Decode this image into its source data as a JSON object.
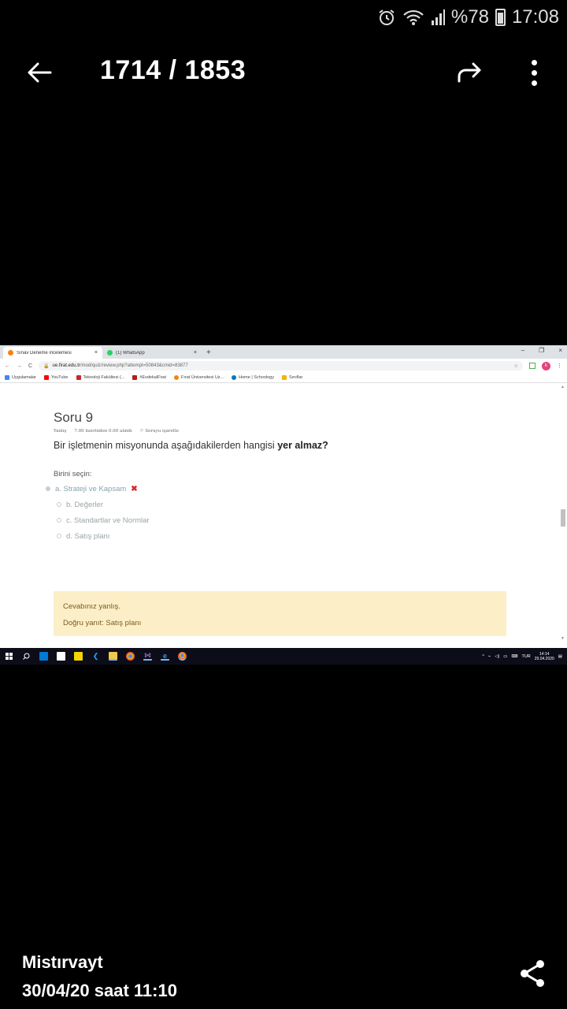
{
  "status_bar": {
    "battery": "%78",
    "time": "17:08",
    "icons": [
      "alarm-icon",
      "wifi-icon",
      "signal-icon",
      "battery-icon"
    ]
  },
  "app_bar": {
    "counter": "1714 / 1853",
    "icons": [
      "back-arrow-icon",
      "share-arrow-icon",
      "more-vert-icon"
    ]
  },
  "browser": {
    "tabs": [
      {
        "title": "Sınav Deneme incelemesi",
        "close": "×",
        "favicon_color": "#f98012"
      },
      {
        "title": "(1) WhatsApp",
        "close": "×",
        "favicon_color": "#25d366"
      }
    ],
    "new_tab": "+",
    "window_controls": [
      "–",
      "❐",
      "×"
    ],
    "nav": {
      "back": "←",
      "forward": "→",
      "reload": "C"
    },
    "url_host": "ue.firat.edu.tr",
    "url_path": "/mod/quiz/review.php?attempt=50843&cmid=83877",
    "profile_initial": "k",
    "bookmarks": [
      {
        "label": "Uygulamalar",
        "color": "#4285f4"
      },
      {
        "label": "YouTube",
        "color": "#ff0000"
      },
      {
        "label": "Teknoloji Fakültesi (...",
        "color": "#c62828"
      },
      {
        "label": "#EvdekalFirat",
        "color": "#b71c1c"
      },
      {
        "label": "Fırat Üniversitesi Uz...",
        "color": "#f98012"
      },
      {
        "label": "Home | Schoology",
        "color": "#0277bd"
      },
      {
        "label": "Sınıflar",
        "color": "#f4b400"
      }
    ]
  },
  "quiz": {
    "title": "Soru 9",
    "meta_status": "Yanlış",
    "meta_score": "7.00 üzerinden 0.00 alındı",
    "meta_flag": "Soruyu işaretle",
    "question_prefix": "Bir işletmenin misyonunda aşağıdakilerden hangisi ",
    "question_bold": "yer almaz?",
    "prompt": "Birini seçin:",
    "options": [
      {
        "label": "a. Strateji ve Kapsam",
        "selected": true,
        "wrong_mark": "✖"
      },
      {
        "label": "b. Değerler",
        "selected": false
      },
      {
        "label": "c. Standartlar ve Normlar",
        "selected": false
      },
      {
        "label": "d. Satış planı",
        "selected": false
      }
    ],
    "feedback_result": "Cevabınız yanlış.",
    "feedback_answer": "Doğru yanıt: Satış planı"
  },
  "taskbar": {
    "language": "TUR",
    "time": "14:14",
    "date": "29.04.2020"
  },
  "footer": {
    "sender": "Mistırvayt",
    "datetime": "30/04/20 saat 11:10"
  }
}
